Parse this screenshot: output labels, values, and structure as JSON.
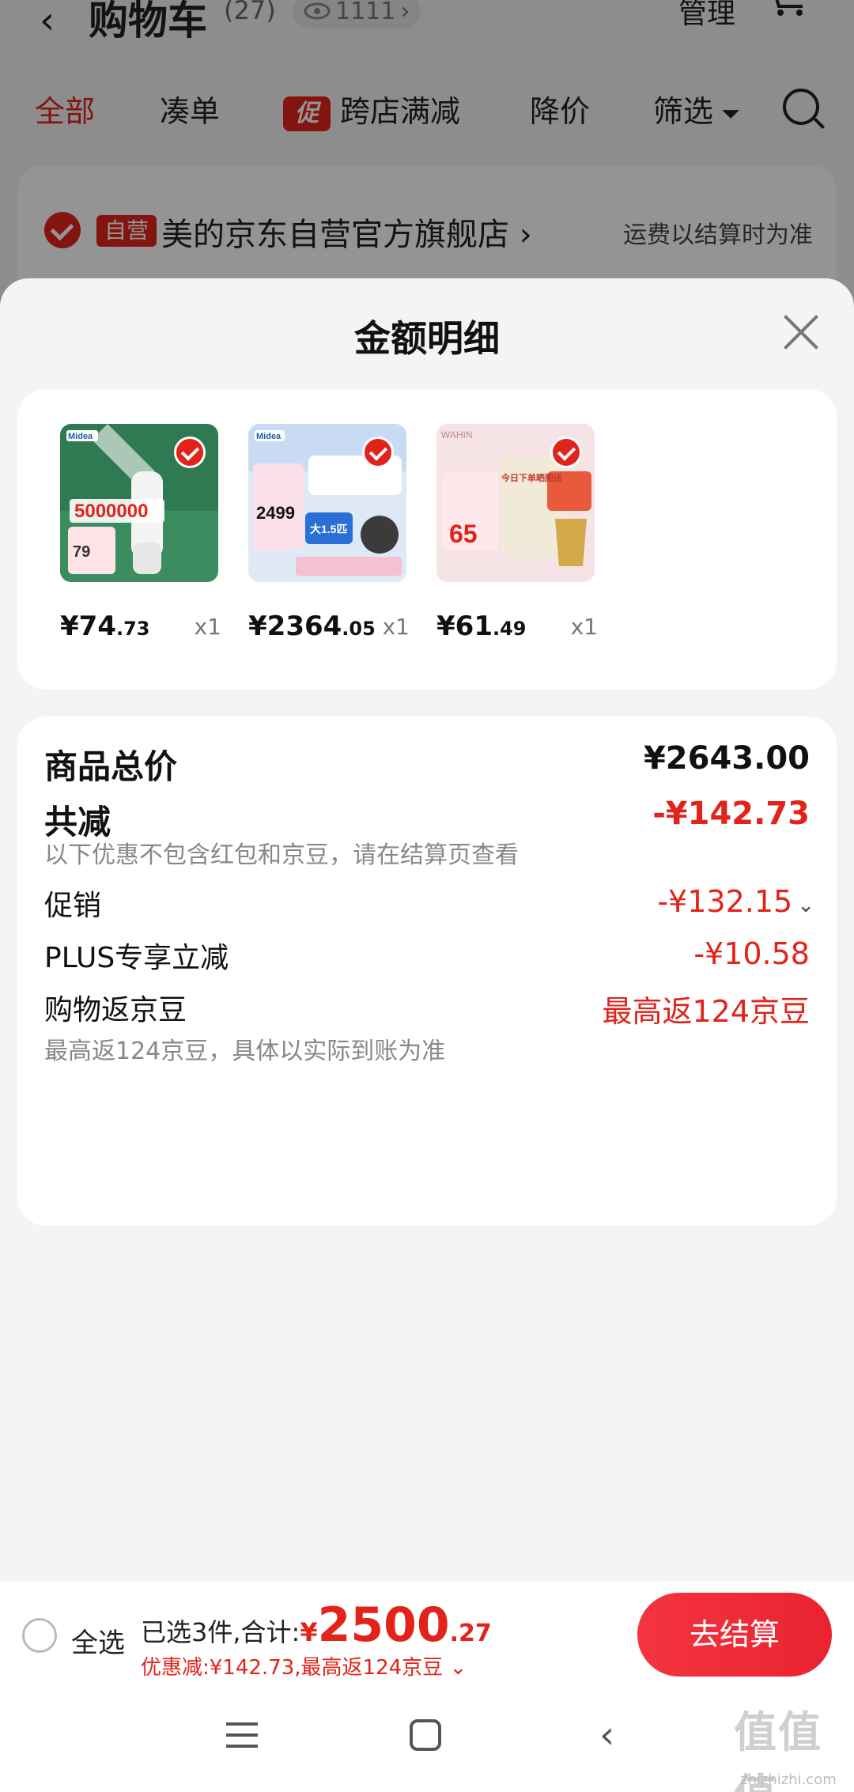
{
  "background": {
    "title": "购物车",
    "count": "(27)",
    "views": "1111",
    "manage": "管理",
    "tabs": [
      "全部",
      "凑单",
      "跨店满减",
      "降价",
      "筛选"
    ],
    "promo_badge": "促",
    "store": {
      "badge": "自营",
      "name": "美的京东自营官方旗舰店",
      "shipping": "运费以结算时为准"
    }
  },
  "sheet": {
    "title": "金额明细",
    "products": [
      {
        "price_int": "¥74",
        "price_dec": ".73",
        "qty": "x1",
        "brand": "Midea",
        "promo": "5000000",
        "shown_price": "79"
      },
      {
        "price_int": "¥2364",
        "price_dec": ".05",
        "qty": "x1",
        "brand": "Midea",
        "promo": "大1.5匹",
        "shown_price": "2499"
      },
      {
        "price_int": "¥61",
        "price_dec": ".49",
        "qty": "x1",
        "brand": "WAHIN",
        "promo": "今日下单晒图送",
        "shown_price": "65"
      }
    ],
    "rows": {
      "total_label": "商品总价",
      "total_value": "¥2643.00",
      "discount_label": "共减",
      "discount_value": "-¥142.73",
      "discount_note": "以下优惠不包含红包和京豆，请在结算页查看",
      "promo_label": "促销",
      "promo_value": "-¥132.15",
      "plus_label": "PLUS专享立减",
      "plus_value": "-¥10.58",
      "beans_label": "购物返京豆",
      "beans_value": "最高返124京豆",
      "beans_note": "最高返124京豆，具体以实际到账为准"
    }
  },
  "bottom_bar": {
    "select_all": "全选",
    "selected_text": "已选3件,合计:",
    "yen": "¥",
    "total_int": "2500",
    "total_dec": ".27",
    "savings": "优惠减:¥142.73,最高返124京豆",
    "checkout": "去结算"
  },
  "watermark": {
    "logo": "值值值",
    "site": "zhizhizhi.com"
  },
  "colors": {
    "accent": "#e2231a",
    "sheet_bg": "#f4f4f4"
  }
}
